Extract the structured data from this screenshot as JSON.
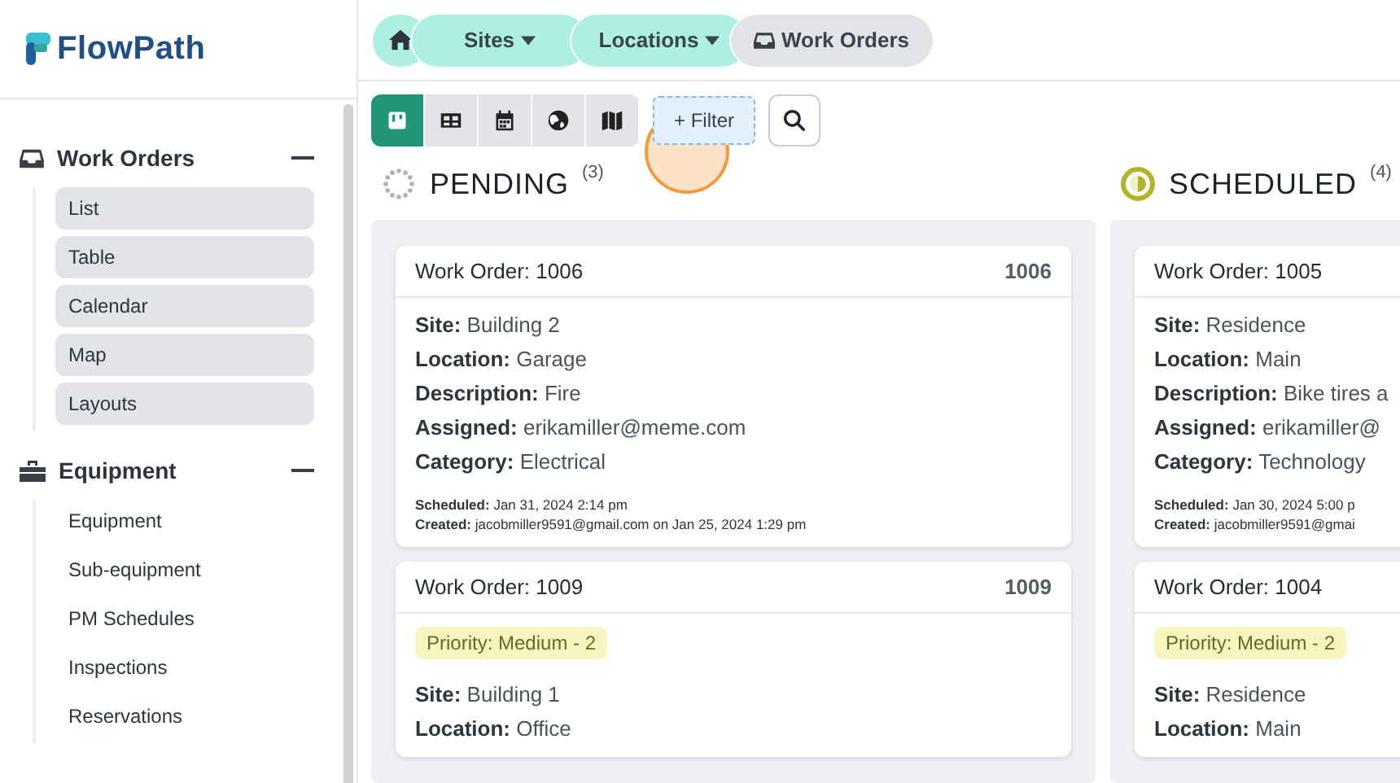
{
  "logo": {
    "name": "FlowPath"
  },
  "breadcrumb": [
    {
      "kind": "home"
    },
    {
      "kind": "dropdown",
      "label": "Sites"
    },
    {
      "kind": "dropdown",
      "label": "Locations"
    },
    {
      "kind": "current",
      "label": "Work Orders"
    }
  ],
  "views": [
    {
      "kind": "board",
      "selected": true
    },
    {
      "kind": "table",
      "selected": false
    },
    {
      "kind": "calendar",
      "selected": false
    },
    {
      "kind": "globe",
      "selected": false
    },
    {
      "kind": "map",
      "selected": false
    }
  ],
  "filter": {
    "label": "+ Filter"
  },
  "sidebar": [
    {
      "kind": "inbox",
      "title": "Work Orders",
      "expanded": true,
      "items": [
        {
          "label": "List",
          "highlighted": true
        },
        {
          "label": "Table",
          "highlighted": true
        },
        {
          "label": "Calendar",
          "highlighted": true
        },
        {
          "label": "Map",
          "highlighted": true
        },
        {
          "label": "Layouts",
          "highlighted": true
        }
      ]
    },
    {
      "kind": "toolbox",
      "title": "Equipment",
      "expanded": true,
      "items": [
        {
          "label": "Equipment",
          "highlighted": false
        },
        {
          "label": "Sub-equipment",
          "highlighted": false
        },
        {
          "label": "PM Schedules",
          "highlighted": false
        },
        {
          "label": "Inspections",
          "highlighted": false
        },
        {
          "label": "Reservations",
          "highlighted": false
        }
      ]
    }
  ],
  "columns": [
    {
      "kind": "pending",
      "title": "PENDING",
      "count": "(3)",
      "cards": [
        {
          "title": "Work Order: 1006",
          "number": "1006",
          "fields": [
            {
              "label": "Site:",
              "value": "Building 2"
            },
            {
              "label": "Location:",
              "value": "Garage"
            },
            {
              "label": "Description:",
              "value": "Fire"
            },
            {
              "label": "Assigned:",
              "value": "erikamiller@meme.com"
            },
            {
              "label": "Category:",
              "value": "Electrical"
            }
          ],
          "scheduled_label": "Scheduled:",
          "scheduled": "Jan 31, 2024 2:14 pm",
          "created_label": "Created:",
          "created": "jacobmiller9591@gmail.com on Jan 25, 2024 1:29 pm"
        },
        {
          "title": "Work Order: 1009",
          "number": "1009",
          "priority": "Priority: Medium - 2",
          "fields": [
            {
              "label": "Site:",
              "value": "Building 1"
            },
            {
              "label": "Location:",
              "value": "Office"
            }
          ]
        }
      ]
    },
    {
      "kind": "scheduled",
      "title": "SCHEDULED",
      "count": "(4)",
      "cards": [
        {
          "title": "Work Order: 1005",
          "fields": [
            {
              "label": "Site:",
              "value": "Residence"
            },
            {
              "label": "Location:",
              "value": "Main"
            },
            {
              "label": "Description:",
              "value": "Bike tires a"
            },
            {
              "label": "Assigned:",
              "value": "erikamiller@"
            },
            {
              "label": "Category:",
              "value": "Technology"
            }
          ],
          "scheduled_label": "Scheduled:",
          "scheduled": "Jan 30, 2024 5:00 p",
          "created_label": "Created:",
          "created": "jacobmiller9591@gmai"
        },
        {
          "title": "Work Order: 1004",
          "priority": "Priority: Medium - 2",
          "fields": [
            {
              "label": "Site:",
              "value": "Residence"
            },
            {
              "label": "Location:",
              "value": "Main"
            }
          ]
        }
      ]
    }
  ]
}
